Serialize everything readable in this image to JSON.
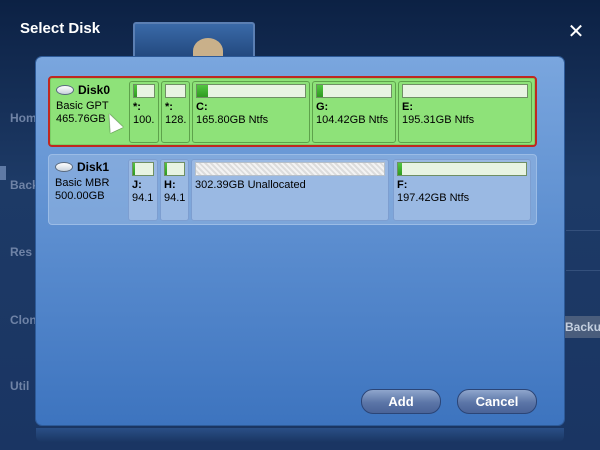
{
  "dialog": {
    "title": "Select Disk",
    "close_icon": "close-icon"
  },
  "background": {
    "sidebar": [
      "Hom",
      "Back",
      "Res",
      "Clon",
      "Util"
    ],
    "backup_button": "Backu"
  },
  "disks": [
    {
      "name": "Disk0",
      "type": "Basic GPT",
      "size": "465.76GB",
      "selected": true,
      "partitions": [
        {
          "label": "*:",
          "size": "100.",
          "fill": 0.15
        },
        {
          "label": "*:",
          "size": "128.",
          "fill": 0.0
        },
        {
          "label": "C:",
          "size": "165.80GB Ntfs",
          "fill": 0.1
        },
        {
          "label": "G:",
          "size": "104.42GB Ntfs",
          "fill": 0.08
        },
        {
          "label": "E:",
          "size": "195.31GB Ntfs",
          "fill": 0.0
        }
      ]
    },
    {
      "name": "Disk1",
      "type": "Basic MBR",
      "size": "500.00GB",
      "selected": false,
      "partitions": [
        {
          "label": "J:",
          "size": "94.1",
          "fill": 0.1
        },
        {
          "label": "H:",
          "size": "94.1",
          "fill": 0.1
        },
        {
          "label": "",
          "size": "302.39GB Unallocated",
          "fill": 0.0,
          "unallocated": true
        },
        {
          "label": "F:",
          "size": "197.42GB Ntfs",
          "fill": 0.03
        }
      ]
    }
  ],
  "buttons": {
    "add": "Add",
    "cancel": "Cancel"
  },
  "colors": {
    "selected_border": "#c0281f",
    "selected_bg": "#8ee279",
    "usage_fill": "#2e9b20"
  }
}
